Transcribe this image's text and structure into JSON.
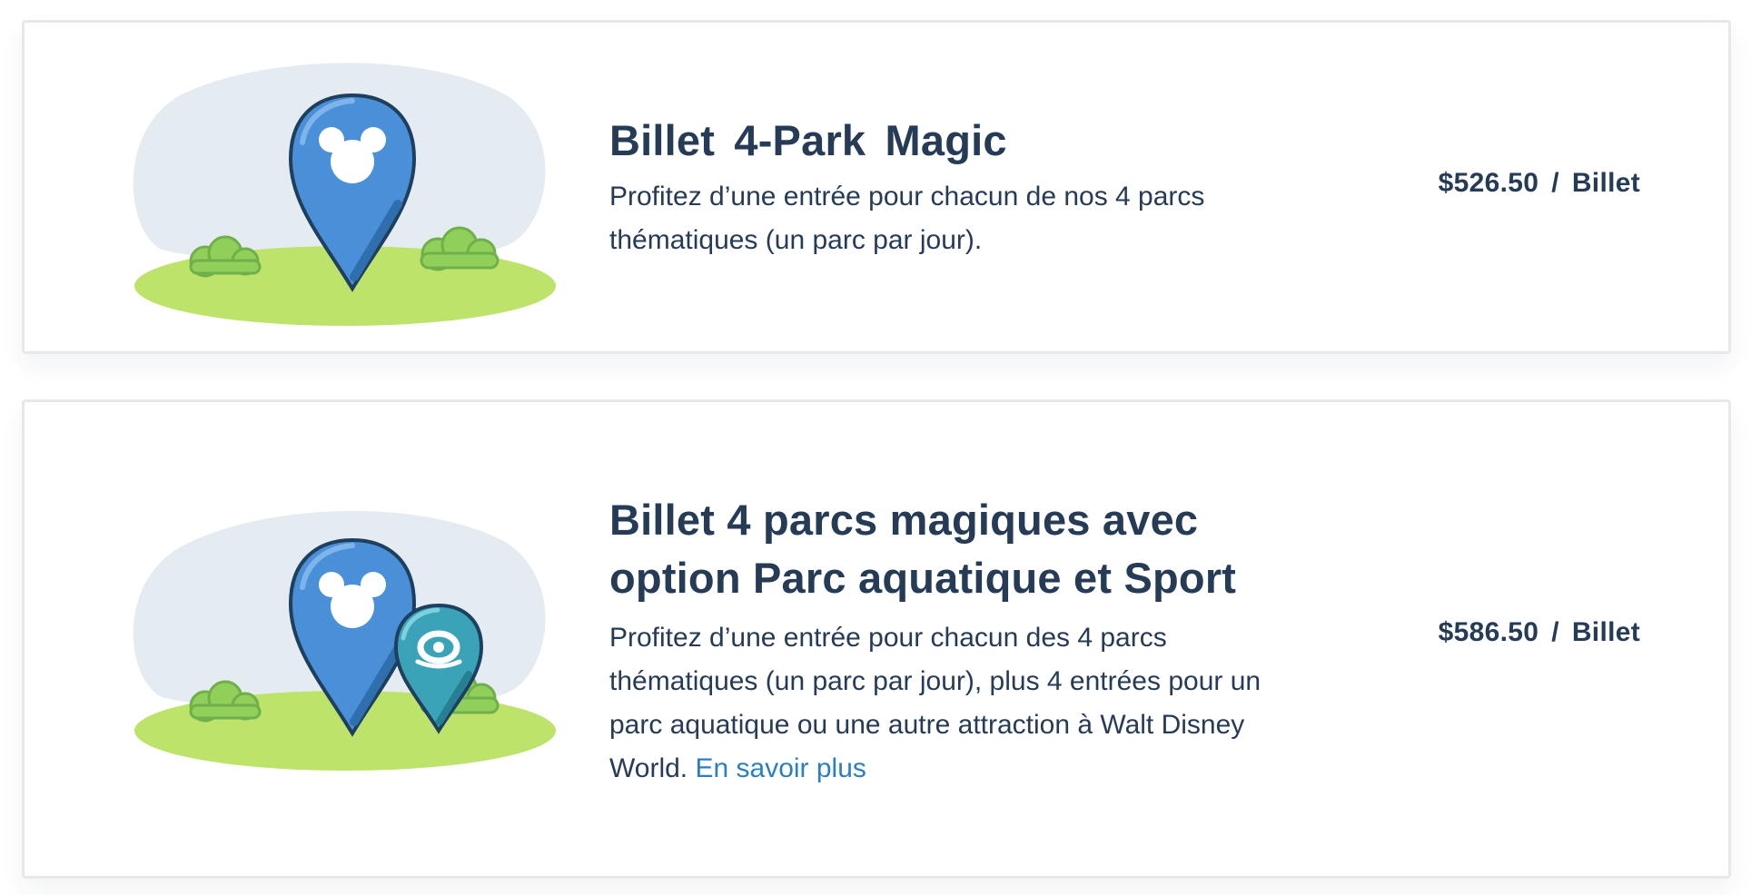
{
  "tickets": [
    {
      "title": "Billet 4-Park Magic",
      "description": "Profitez d’une entrée pour chacun de nos 4 parcs thématiques (un parc par jour).",
      "price": "$526.50",
      "separator": "/",
      "unit": "Billet",
      "icons": [
        "mickey-pin-icon"
      ]
    },
    {
      "title": "Billet 4 parcs magiques avec option Parc aquatique et Sport",
      "description": "Profitez d’une entrée pour chacun des 4 parcs thématiques (un parc par jour), plus 4 entrées pour un parc aquatique ou une autre attraction à Walt Disney World.",
      "link_label": "En savoir plus",
      "price": "$586.50",
      "separator": "/",
      "unit": "Billet",
      "icons": [
        "mickey-pin-icon",
        "water-park-pin-icon"
      ]
    }
  ],
  "colors": {
    "text": "#253b56",
    "link": "#2a7fc2",
    "pin_blue": "#4a90d9",
    "pin_teal": "#3aa3b8",
    "grass": "#bde36a",
    "sky": "#e4ecf2",
    "bush": "#8fcf5a"
  }
}
